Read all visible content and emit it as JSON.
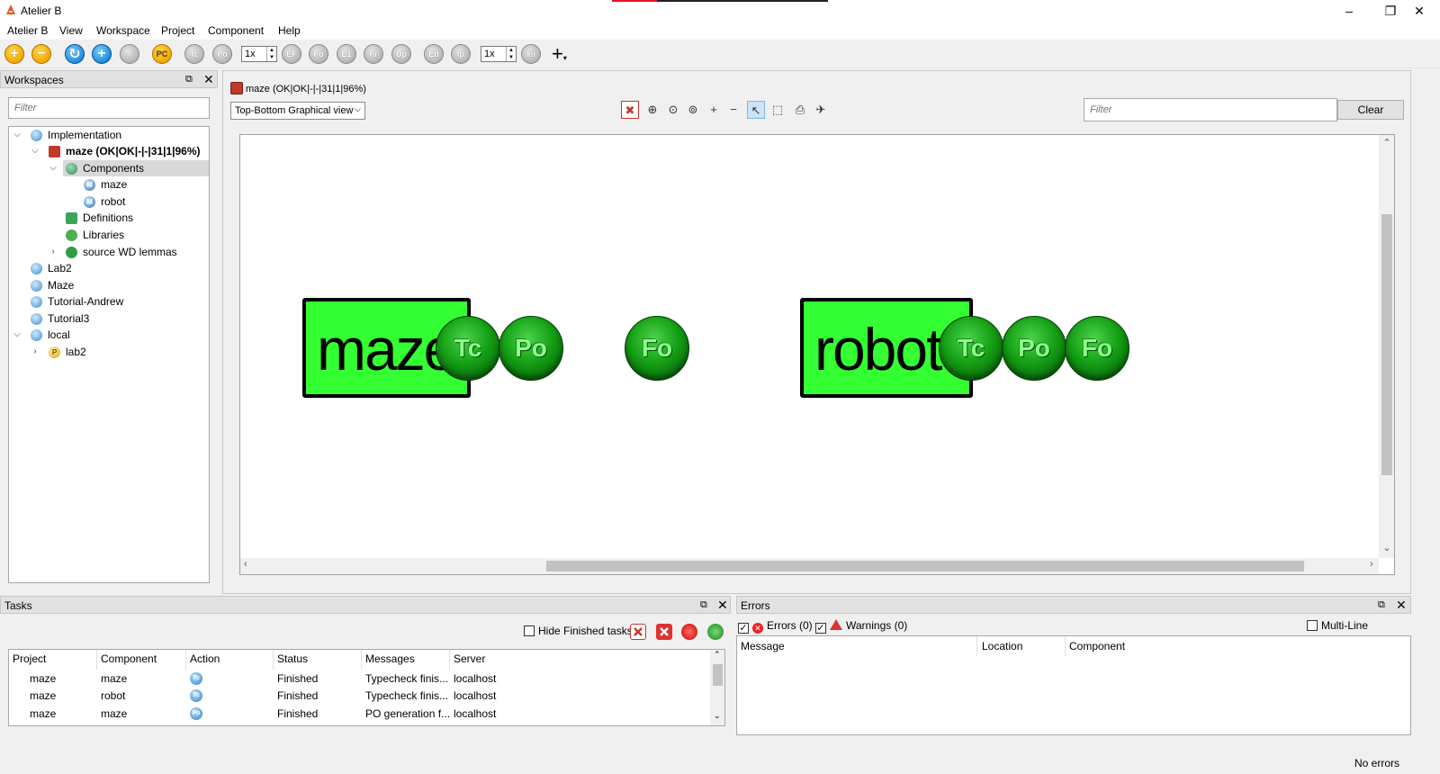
{
  "window": {
    "title": "Atelier B",
    "controls": [
      "–",
      "❐",
      "✕"
    ]
  },
  "menu": {
    "items": [
      {
        "label": "Atelier B"
      },
      {
        "label": "View"
      },
      {
        "label": "Workspace"
      },
      {
        "label": "Project"
      },
      {
        "label": "Component"
      },
      {
        "label": "Help"
      }
    ]
  },
  "toolbar": {
    "spin1_value": "1x",
    "spin2_value": "1x",
    "buttons": [
      "add",
      "remove",
      "refresh",
      "add-blue",
      "remove-grey",
      "project-check",
      "Tc",
      "Po",
      "Ef",
      "Fo",
      "Et",
      "Fr",
      "Up",
      "Ed",
      "Ip",
      "Xtr"
    ],
    "labels": {
      "Tc": "Tc",
      "Po": "Po",
      "Ef": "EF",
      "Fo": "Fo",
      "Et": "E1",
      "Fr": "Fr",
      "Up": "Up",
      "Ed": "Ed",
      "Ip": "Ip",
      "Xtr": "Xtr",
      "pc": "PC"
    }
  },
  "workspaces": {
    "title": "Workspaces",
    "filter_placeholder": "Filter",
    "tree": {
      "implementation": "Implementation",
      "project": "maze (OK|OK|-|-|31|1|96%)",
      "components": "Components",
      "comp_maze": "maze",
      "comp_robot": "robot",
      "definitions": "Definitions",
      "libraries": "Libraries",
      "lemmas": "source WD lemmas",
      "lab2": "Lab2",
      "maze_ws": "Maze",
      "tutorial_andrew": "Tutorial-Andrew",
      "tutorial3": "Tutorial3",
      "local": "local",
      "local_lab2": "lab2"
    }
  },
  "main": {
    "title": "maze (OK|OK|-|-|31|1|96%)",
    "view_select": "Top-Bottom Graphical view",
    "filter_placeholder": "Filter",
    "clear_label": "Clear",
    "graph": {
      "maze_label": "maze",
      "robot_label": "robot",
      "tc": "Tc",
      "po": "Po",
      "fo": "Fo"
    }
  },
  "tasks": {
    "title": "Tasks",
    "hide_finished_label": "Hide Finished tasks",
    "columns": [
      "Project",
      "Component",
      "Action",
      "Status",
      "Messages",
      "Server"
    ],
    "rows": [
      {
        "project": "maze",
        "component": "maze",
        "action": "Tc",
        "status": "Finished",
        "messages": "Typecheck finis...",
        "server": "localhost"
      },
      {
        "project": "maze",
        "component": "robot",
        "action": "Tc",
        "status": "Finished",
        "messages": "Typecheck finis...",
        "server": "localhost"
      },
      {
        "project": "maze",
        "component": "maze",
        "action": "Po",
        "status": "Finished",
        "messages": "PO generation f...",
        "server": "localhost"
      }
    ]
  },
  "errors": {
    "title": "Errors",
    "errors_label": "Errors (0)",
    "warnings_label": "Warnings (0)",
    "multiline_label": "Multi-Line messages",
    "columns": [
      "Message",
      "Location",
      "Component"
    ]
  },
  "status": {
    "text": "No errors"
  }
}
